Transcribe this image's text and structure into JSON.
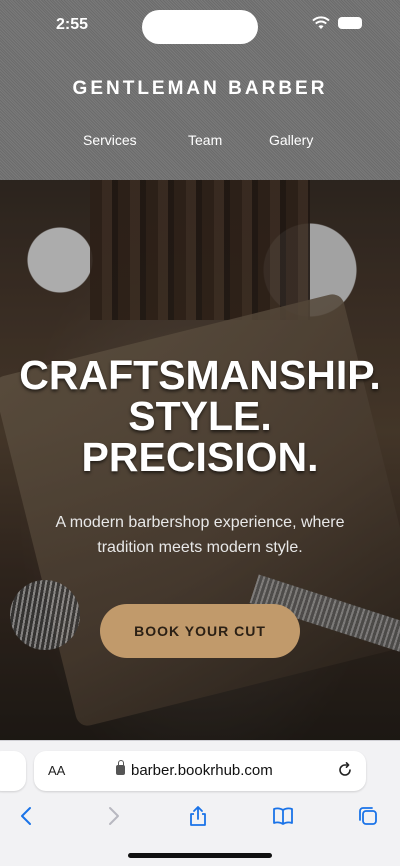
{
  "status": {
    "time": "2:55"
  },
  "site": {
    "brand": "GENTLEMAN BARBER",
    "nav": [
      "Services",
      "Team",
      "Gallery"
    ]
  },
  "hero": {
    "headline": [
      "CRAFTSMANSHIP.",
      "STYLE.",
      "PRECISION."
    ],
    "tagline": "A modern barbershop experience, where tradition meets modern style.",
    "cta": "BOOK YOUR CUT"
  },
  "browser": {
    "text_size_label": "AA",
    "url": "barber.bookrhub.com",
    "toolbar_icons": [
      "back-icon",
      "forward-icon",
      "share-icon",
      "bookmarks-icon",
      "tabs-icon"
    ]
  },
  "colors": {
    "accent": "#c19a6b",
    "toolbar_blue": "#1a73e8"
  }
}
